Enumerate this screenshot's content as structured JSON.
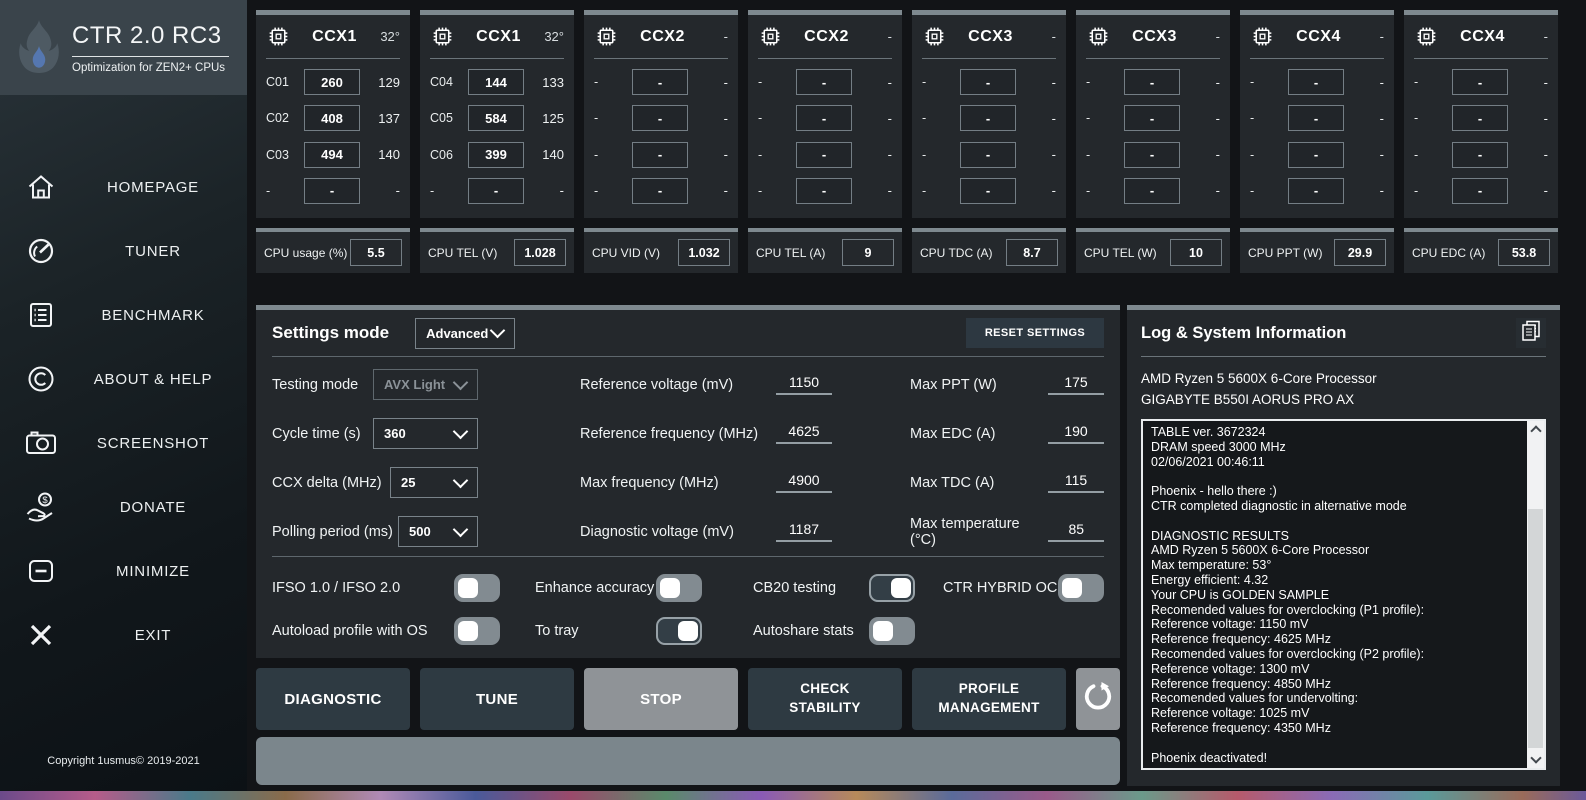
{
  "app": {
    "name": "CTR 2.0 RC3",
    "subtitle": "Optimization for ZEN2+ CPUs"
  },
  "sidebar": {
    "items": [
      {
        "id": "homepage",
        "label": "HOMEPAGE",
        "icon": "home-icon"
      },
      {
        "id": "tuner",
        "label": "TUNER",
        "icon": "gauge-icon"
      },
      {
        "id": "benchmark",
        "label": "BENCHMARK",
        "icon": "list-icon"
      },
      {
        "id": "about-help",
        "label": "ABOUT & HELP",
        "icon": "copyright-icon"
      },
      {
        "id": "screenshot",
        "label": "SCREENSHOT",
        "icon": "camera-icon"
      },
      {
        "id": "donate",
        "label": "DONATE",
        "icon": "donate-icon"
      },
      {
        "id": "minimize",
        "label": "MINIMIZE",
        "icon": "minimize-icon"
      },
      {
        "id": "exit",
        "label": "EXIT",
        "icon": "close-icon"
      }
    ],
    "copyright": "Copyright 1usmus© 2019-2021"
  },
  "ccx_panels": [
    {
      "title": "CCX1",
      "temp": "32°",
      "rows": [
        {
          "core": "C01",
          "value": "260",
          "score": "129"
        },
        {
          "core": "C02",
          "value": "408",
          "score": "137"
        },
        {
          "core": "C03",
          "value": "494",
          "score": "140"
        },
        {
          "core": "-",
          "value": "-",
          "score": "-"
        }
      ]
    },
    {
      "title": "CCX1",
      "temp": "32°",
      "rows": [
        {
          "core": "C04",
          "value": "144",
          "score": "133"
        },
        {
          "core": "C05",
          "value": "584",
          "score": "125"
        },
        {
          "core": "C06",
          "value": "399",
          "score": "140"
        },
        {
          "core": "-",
          "value": "-",
          "score": "-"
        }
      ]
    },
    {
      "title": "CCX2",
      "temp": "-",
      "rows": [
        {
          "core": "-",
          "value": "-",
          "score": "-"
        },
        {
          "core": "-",
          "value": "-",
          "score": "-"
        },
        {
          "core": "-",
          "value": "-",
          "score": "-"
        },
        {
          "core": "-",
          "value": "-",
          "score": "-"
        }
      ]
    },
    {
      "title": "CCX2",
      "temp": "-",
      "rows": [
        {
          "core": "-",
          "value": "-",
          "score": "-"
        },
        {
          "core": "-",
          "value": "-",
          "score": "-"
        },
        {
          "core": "-",
          "value": "-",
          "score": "-"
        },
        {
          "core": "-",
          "value": "-",
          "score": "-"
        }
      ]
    },
    {
      "title": "CCX3",
      "temp": "-",
      "rows": [
        {
          "core": "-",
          "value": "-",
          "score": "-"
        },
        {
          "core": "-",
          "value": "-",
          "score": "-"
        },
        {
          "core": "-",
          "value": "-",
          "score": "-"
        },
        {
          "core": "-",
          "value": "-",
          "score": "-"
        }
      ]
    },
    {
      "title": "CCX3",
      "temp": "-",
      "rows": [
        {
          "core": "-",
          "value": "-",
          "score": "-"
        },
        {
          "core": "-",
          "value": "-",
          "score": "-"
        },
        {
          "core": "-",
          "value": "-",
          "score": "-"
        },
        {
          "core": "-",
          "value": "-",
          "score": "-"
        }
      ]
    },
    {
      "title": "CCX4",
      "temp": "-",
      "rows": [
        {
          "core": "-",
          "value": "-",
          "score": "-"
        },
        {
          "core": "-",
          "value": "-",
          "score": "-"
        },
        {
          "core": "-",
          "value": "-",
          "score": "-"
        },
        {
          "core": "-",
          "value": "-",
          "score": "-"
        }
      ]
    },
    {
      "title": "CCX4",
      "temp": "-",
      "rows": [
        {
          "core": "-",
          "value": "-",
          "score": "-"
        },
        {
          "core": "-",
          "value": "-",
          "score": "-"
        },
        {
          "core": "-",
          "value": "-",
          "score": "-"
        },
        {
          "core": "-",
          "value": "-",
          "score": "-"
        }
      ]
    }
  ],
  "cpu_stats": [
    {
      "label": "CPU usage (%)",
      "value": "5.5"
    },
    {
      "label": "CPU TEL (V)",
      "value": "1.028"
    },
    {
      "label": "CPU VID (V)",
      "value": "1.032"
    },
    {
      "label": "CPU TEL (A)",
      "value": "9"
    },
    {
      "label": "CPU TDC (A)",
      "value": "8.7"
    },
    {
      "label": "CPU TEL (W)",
      "value": "10"
    },
    {
      "label": "CPU PPT (W)",
      "value": "29.9"
    },
    {
      "label": "CPU EDC (A)",
      "value": "53.8"
    }
  ],
  "settings": {
    "title": "Settings mode",
    "mode_value": "Advanced",
    "reset_label": "RESET SETTINGS",
    "rows": [
      {
        "col1": {
          "label": "Testing mode",
          "value": "AVX Light",
          "disabled": true
        },
        "col2": {
          "label": "Reference voltage (mV)",
          "value": "1150"
        },
        "col3": {
          "label": "Max PPT (W)",
          "value": "175"
        }
      },
      {
        "col1": {
          "label": "Cycle time (s)",
          "value": "360",
          "disabled": false
        },
        "col2": {
          "label": "Reference frequency (MHz)",
          "value": "4625"
        },
        "col3": {
          "label": "Max EDC (A)",
          "value": "190"
        }
      },
      {
        "col1": {
          "label": "CCX delta (MHz)",
          "value": "25",
          "disabled": false
        },
        "col2": {
          "label": "Max frequency (MHz)",
          "value": "4900"
        },
        "col3": {
          "label": "Max TDC (A)",
          "value": "115"
        }
      },
      {
        "col1": {
          "label": "Polling period (ms)",
          "value": "500",
          "disabled": false
        },
        "col2": {
          "label": "Diagnostic voltage (mV)",
          "value": "1187"
        },
        "col3": {
          "label": "Max temperature (°C)",
          "value": "85"
        }
      }
    ],
    "toggle_rows": [
      [
        {
          "label": "IFSO 1.0 / IFSO 2.0",
          "on": false
        },
        {
          "label": "Enhance accuracy",
          "on": false
        },
        {
          "label": "CB20 testing",
          "on": true
        },
        {
          "label": "CTR HYBRID OC",
          "on": false
        }
      ],
      [
        {
          "label": "Autoload profile with OS",
          "on": false
        },
        {
          "label": "To tray",
          "on": true
        },
        {
          "label": "Autoshare stats",
          "on": false
        },
        null
      ]
    ]
  },
  "actions": [
    {
      "label": "DIAGNOSTIC",
      "variant": "dark",
      "two_line": false
    },
    {
      "label": "TUNE",
      "variant": "dark",
      "two_line": false
    },
    {
      "label": "STOP",
      "variant": "gray",
      "two_line": false
    },
    {
      "label": "CHECK STABILITY",
      "variant": "dark",
      "two_line": true
    },
    {
      "label": "PROFILE MANAGEMENT",
      "variant": "dark",
      "two_line": true
    },
    {
      "icon": "refresh-icon",
      "variant": "gray"
    }
  ],
  "log_panel": {
    "title": "Log & System Information",
    "system_lines": [
      "AMD Ryzen 5 5600X 6-Core Processor",
      "GIGABYTE B550I AORUS PRO AX"
    ],
    "log_lines": [
      "TABLE ver. 3672324",
      "DRAM speed 3000 MHz",
      "02/06/2021 00:46:11",
      "",
      "Phoenix - hello there :)",
      "CTR completed diagnostic in alternative mode",
      "",
      "DIAGNOSTIC RESULTS",
      "AMD Ryzen 5 5600X 6-Core Processor",
      "Max temperature: 53°",
      "Energy efficient: 4.32",
      "Your CPU is GOLDEN SAMPLE",
      "Recomended values for overclocking (P1 profile):",
      "Reference voltage: 1150 mV",
      "Reference frequency: 4625 MHz",
      "Recomended values for overclocking (P2 profile):",
      "Reference voltage: 1300 mV",
      "Reference frequency: 4850 MHz",
      "Recomended values for undervolting:",
      "Reference voltage: 1025 mV",
      "Reference frequency: 4350 MHz",
      "",
      "Phoenix deactivated!"
    ]
  },
  "colors": {
    "panel_strip": "#7e898f",
    "button_dark": "#2e3a42",
    "button_gray": "#8f9397",
    "toggle_off": "#828b91",
    "toggle_on": "#333e46",
    "flame_accent": "#5577b0",
    "log_bg": "#15181b"
  }
}
